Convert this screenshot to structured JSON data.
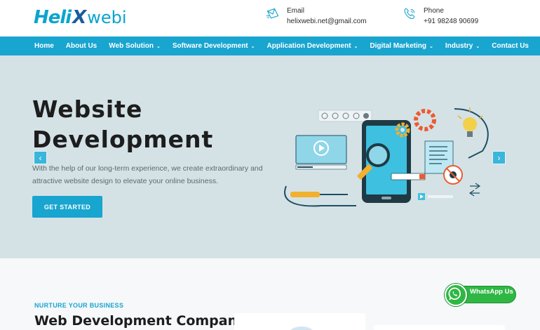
{
  "logo": {
    "part1": "Heli",
    "part2": "X",
    "part3": "webi"
  },
  "contact": {
    "email_label": "Email",
    "email_value": "helixwebi.net@gmail.com",
    "phone_label": "Phone",
    "phone_value": "+91 98248 90699"
  },
  "nav": {
    "items": [
      {
        "label": "Home",
        "dropdown": false
      },
      {
        "label": "About Us",
        "dropdown": false
      },
      {
        "label": "Web Solution",
        "dropdown": true
      },
      {
        "label": "Software Development",
        "dropdown": true
      },
      {
        "label": "Application Development",
        "dropdown": true
      },
      {
        "label": "Digital Marketing",
        "dropdown": true
      },
      {
        "label": "Industry",
        "dropdown": true
      },
      {
        "label": "Contact Us",
        "dropdown": false
      }
    ],
    "chevron": "⌄"
  },
  "hero": {
    "title": "Website Development",
    "description": "With the help of our long-term experience, we create extraordinary and attractive website design to elevate your online business.",
    "cta": "GET STARTED",
    "prev_arrow": "‹",
    "next_arrow": "›"
  },
  "section": {
    "eyebrow": "NURTURE YOUR BUSINESS",
    "title": "Web Development Company"
  },
  "whatsapp": {
    "label": "WhatsApp Us"
  },
  "colors": {
    "accent": "#18a5cf",
    "hero_bg": "#d4e2e6",
    "whatsapp": "#2fb744"
  }
}
